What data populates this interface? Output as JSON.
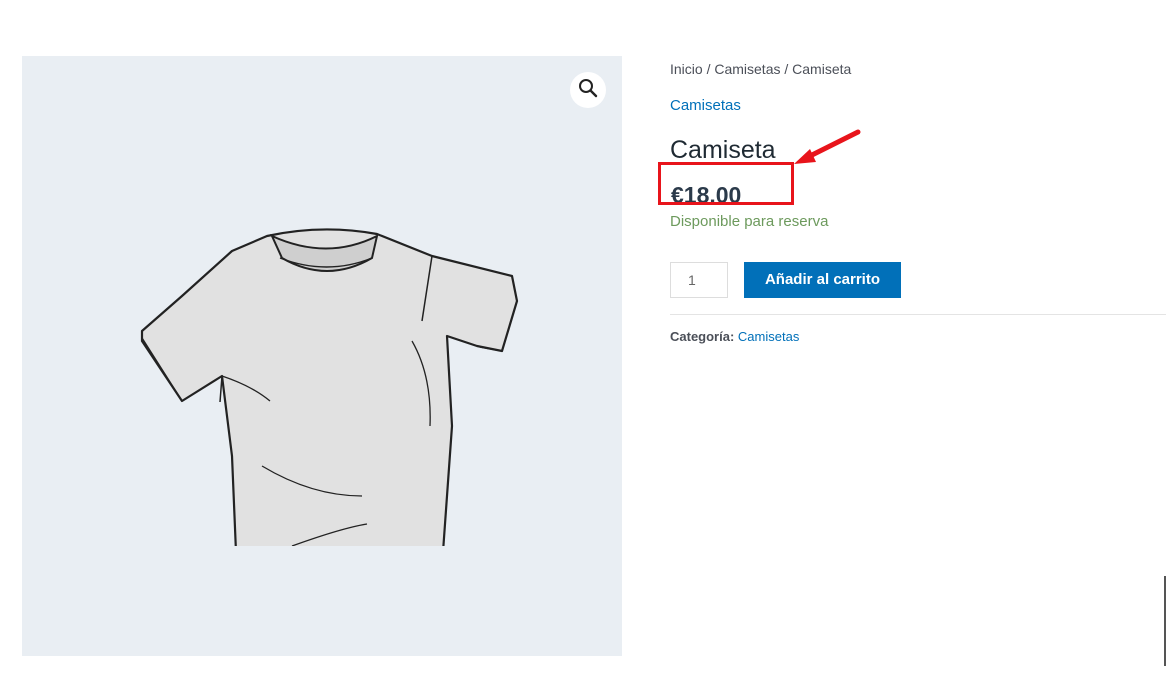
{
  "product": {
    "breadcrumb": "Inicio / Camisetas / Camiseta",
    "category_link": "Camisetas",
    "title": "Camiseta",
    "price": "€18.00",
    "stock_status": "Disponible para reserva",
    "quantity": "1",
    "add_to_cart_label": "Añadir al carrito",
    "meta_label": "Categoría:",
    "meta_value": "Camisetas"
  },
  "gallery": {
    "zoom_icon": "magnifier-icon",
    "image": "t-shirt sketch"
  },
  "annotation": {
    "color": "#e8141b"
  },
  "colors": {
    "accent": "#0170b9",
    "stock": "#6d9a5d",
    "gallery_bg": "#e9eef3"
  }
}
